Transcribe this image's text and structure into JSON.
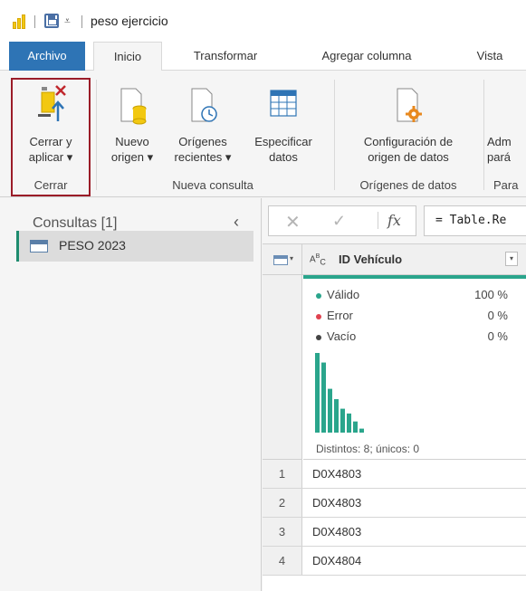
{
  "window": {
    "title": "peso ejercicio"
  },
  "tabs": [
    "Archivo",
    "Inicio",
    "Transformar",
    "Agregar columna",
    "Vista"
  ],
  "ribbon": {
    "close_apply": "Cerrar y\naplicar ▾",
    "new_source": "Nuevo\norigen ▾",
    "recent_sources": "Orígenes\nrecientes ▾",
    "enter_data": "Especificar\ndatos",
    "source_settings": "Configuración de\norigen de datos",
    "manage_params": "Adm\npará",
    "group_close": "Cerrar",
    "group_new_query": "Nueva consulta",
    "group_data_sources": "Orígenes de datos",
    "group_params": "Para"
  },
  "queries": {
    "title": "Consultas [1]",
    "items": [
      {
        "label": "PESO 2023"
      }
    ]
  },
  "formula": {
    "fx": "fx",
    "text": "= Table.Re"
  },
  "column": {
    "type_label": "A B C",
    "name": "ID Vehículo",
    "quality": [
      {
        "label": "Válido",
        "value": "100 %",
        "color": "#2aa58c"
      },
      {
        "label": "Error",
        "value": "0 %",
        "color": "#e0424f"
      },
      {
        "label": "Vacío",
        "value": "0 %",
        "color": "#444444"
      }
    ],
    "histogram": [
      1.0,
      0.88,
      0.55,
      0.42,
      0.3,
      0.24,
      0.14,
      0.05
    ],
    "distinct_text": "Distintos: 8; únicos: 0"
  },
  "rows": [
    {
      "num": "1",
      "value": "D0X4803"
    },
    {
      "num": "2",
      "value": "D0X4803"
    },
    {
      "num": "3",
      "value": "D0X4803"
    },
    {
      "num": "4",
      "value": "D0X4804"
    }
  ],
  "colors": {
    "accent": "#2e74b5",
    "quality": "#2aa58c",
    "highlight": "#9b1c28"
  }
}
